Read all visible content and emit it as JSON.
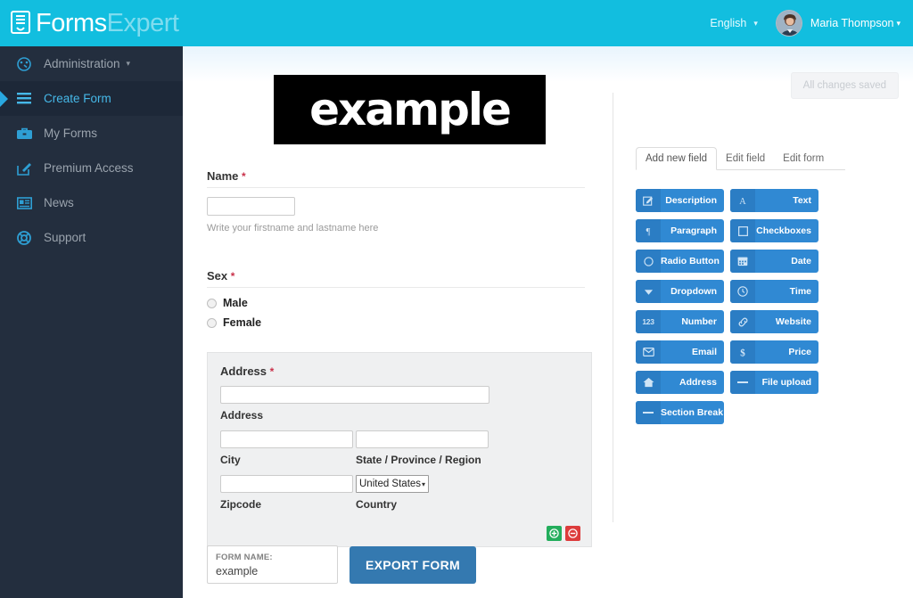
{
  "header": {
    "brand_primary": "Forms",
    "brand_secondary": "Expert",
    "language": "English",
    "language_caret": "▾",
    "user_name": "Maria Thompson",
    "user_caret": "▾",
    "bg_color": "#12bedf"
  },
  "sidebar": {
    "bg_color": "#232e3e",
    "active_color": "#46b8e8",
    "items": [
      {
        "label": "Administration",
        "icon": "dashboard-icon",
        "caret": "▾",
        "active": false
      },
      {
        "label": "Create Form",
        "icon": "menu-icon",
        "caret": "",
        "active": true
      },
      {
        "label": "My Forms",
        "icon": "briefcase-icon",
        "caret": "",
        "active": false
      },
      {
        "label": "Premium Access",
        "icon": "edit-icon",
        "caret": "",
        "active": false
      },
      {
        "label": "News",
        "icon": "newspaper-icon",
        "caret": "",
        "active": false
      },
      {
        "label": "Support",
        "icon": "lifebuoy-icon",
        "caret": "",
        "active": false
      }
    ]
  },
  "content": {
    "saved_badge": "All changes saved",
    "logo_text": "example",
    "fields": {
      "name": {
        "label": "Name",
        "required_mark": "*",
        "value": "",
        "helper": "Write your firstname and lastname here"
      },
      "sex": {
        "label": "Sex",
        "required_mark": "*",
        "options": [
          "Male",
          "Female"
        ]
      },
      "address": {
        "label": "Address",
        "required_mark": "*",
        "street_value": "",
        "street_sub": "Address",
        "city_value": "",
        "city_sub": "City",
        "state_value": "",
        "state_sub": "State / Province / Region",
        "zip_value": "",
        "zip_sub": "Zipcode",
        "country_value": "United States",
        "country_caret": "▾",
        "country_sub": "Country",
        "add_button": "add-row",
        "remove_button": "remove-row"
      }
    },
    "form_name": {
      "caption": "FORM NAME:",
      "value": "example"
    },
    "export_button": "EXPORT FORM"
  },
  "panel": {
    "tabs": [
      {
        "label": "Add new field",
        "active": true
      },
      {
        "label": "Edit field",
        "active": false
      },
      {
        "label": "Edit form",
        "active": false
      }
    ],
    "button_color": "#3089d3",
    "buttons": [
      {
        "label": "Description",
        "icon": "pencil-square-icon"
      },
      {
        "label": "Text",
        "icon": "letter-a-icon"
      },
      {
        "label": "Paragraph",
        "icon": "pilcrow-icon"
      },
      {
        "label": "Checkboxes",
        "icon": "checkbox-icon"
      },
      {
        "label": "Radio Button",
        "icon": "circle-icon"
      },
      {
        "label": "Date",
        "icon": "calendar-icon"
      },
      {
        "label": "Dropdown",
        "icon": "caret-down-icon"
      },
      {
        "label": "Time",
        "icon": "clock-icon"
      },
      {
        "label": "Number",
        "icon": "digits-123-icon"
      },
      {
        "label": "Website",
        "icon": "link-icon"
      },
      {
        "label": "Email",
        "icon": "envelope-icon"
      },
      {
        "label": "Price",
        "icon": "dollar-icon"
      },
      {
        "label": "Address",
        "icon": "home-icon"
      },
      {
        "label": "File upload",
        "icon": "minus-icon"
      },
      {
        "label": "Section Break",
        "icon": "minus-icon"
      }
    ]
  }
}
